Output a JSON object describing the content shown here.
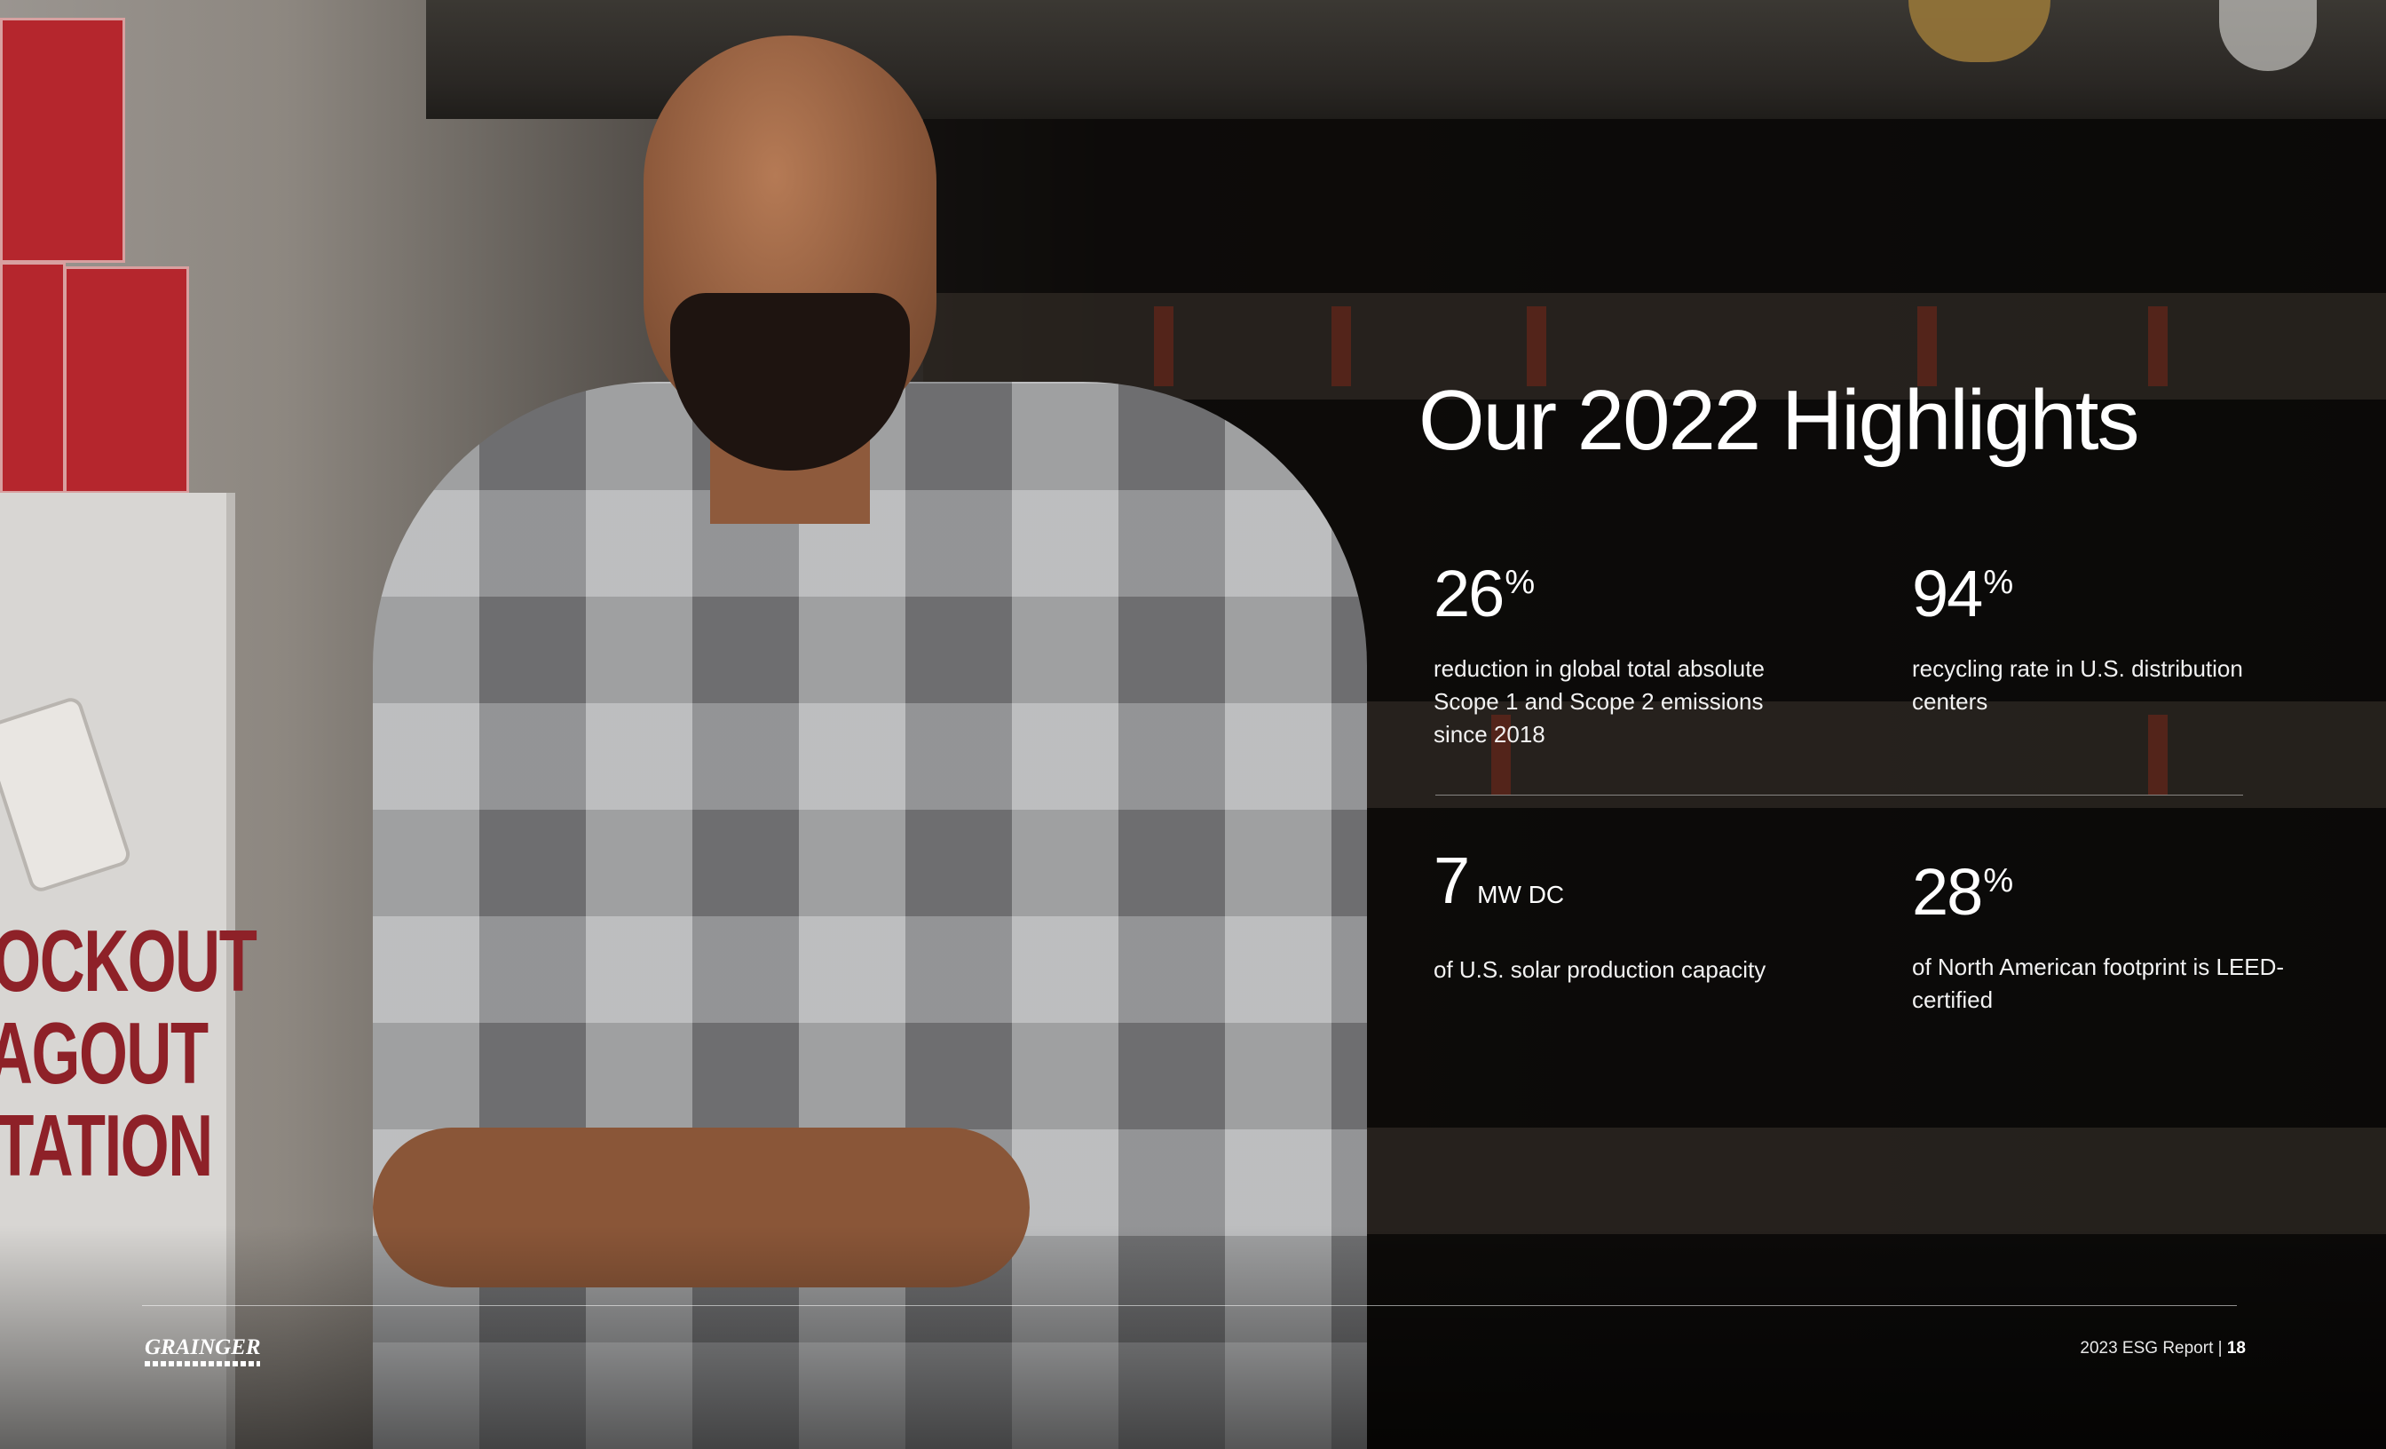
{
  "page": {
    "title": "Our 2022 Highlights",
    "accent_color": "#ffffff",
    "background_color": "#0c0b0a"
  },
  "stats": [
    {
      "value": "26",
      "suffix": "%",
      "description": "reduction in global total absolute Scope 1 and Scope 2 emissions since 2018"
    },
    {
      "value": "94",
      "suffix": "%",
      "description": "recycling rate in U.S. distribution centers"
    },
    {
      "value": "7",
      "unit": "MW DC",
      "description": "of U.S. solar production capacity"
    },
    {
      "value": "28",
      "suffix": "%",
      "description": "of North American footprint is LEED-certified"
    }
  ],
  "photo": {
    "sign_lines": [
      "LOCKOUT",
      "TAGOUT",
      "STATION"
    ]
  },
  "footer": {
    "logo_text": "GRAINGER",
    "report_label": "2023 ESG Report |",
    "page_number": "18"
  }
}
